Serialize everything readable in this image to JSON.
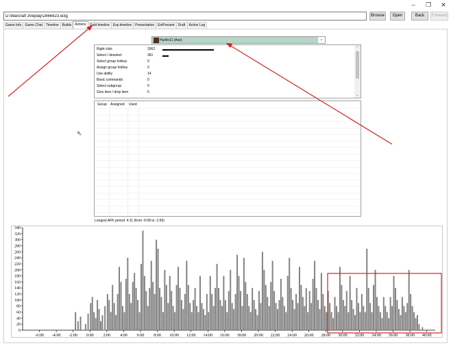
{
  "window": {
    "minimize_glyph": "–",
    "maximize_glyph": "❐",
    "close_glyph": "✕"
  },
  "toolbar": {
    "path_value": "D:\\Warcraft 3\\replay\\2866923.w3g",
    "browse": "Browse",
    "open": "Open",
    "back": "Back",
    "forward": "Forward"
  },
  "tabs": [
    "Game Info",
    "Game Chat",
    "Timeline",
    "Builds",
    "Actions",
    "Gold timeline",
    "Exp timeline",
    "Presentation",
    "ExtPresent",
    "Draft",
    "Action Log"
  ],
  "active_tab": "Actions",
  "player": {
    "name": "Hurillo11 (Axe)",
    "swatch_color": "#5a2b1c",
    "row_color": "#b7d6c7"
  },
  "actions": [
    {
      "label": "Right click",
      "count": "2962",
      "fraction": 1.0
    },
    {
      "label": "Select / deselect",
      "count": "361",
      "fraction": 0.12
    },
    {
      "label": "Select group hotkey",
      "count": "0",
      "fraction": 0
    },
    {
      "label": "Assign group hotkey",
      "count": "0",
      "fraction": 0
    },
    {
      "label": "Use ability",
      "count": "14",
      "fraction": 0
    },
    {
      "label": "Basic commands",
      "count": "0",
      "fraction": 0
    },
    {
      "label": "Select subgroup",
      "count": "0",
      "fraction": 0
    },
    {
      "label": "Give item / drop item",
      "count": "5",
      "fraction": 0
    }
  ],
  "groups": {
    "headers": [
      "Group",
      "Assigned",
      "Used"
    ]
  },
  "afk_text": "Longest AFK period: 4:11 (from -6:08 to -1:56)",
  "chart_data": {
    "type": "bar",
    "title": "",
    "xlabel": "",
    "ylabel": "",
    "ylim": [
      0,
      340
    ],
    "xlim": [
      -8,
      41
    ],
    "y_ticks": [
      0,
      20,
      40,
      60,
      80,
      100,
      120,
      140,
      160,
      180,
      200,
      220,
      240,
      260,
      280,
      300,
      320,
      340
    ],
    "x_tick_labels": [
      "-6:00",
      "-4:00",
      "-2:00",
      "0:00",
      "2:00",
      "4:00",
      "6:00",
      "8:00",
      "10:00",
      "12:00",
      "14:00",
      "16:00",
      "18:00",
      "20:00",
      "22:00",
      "24:00",
      "26:00",
      "28:00",
      "30:00",
      "32:00",
      "34:00",
      "36:00",
      "38:00",
      "40:00"
    ],
    "x_tick_values": [
      -6,
      -4,
      -2,
      0,
      2,
      4,
      6,
      8,
      10,
      12,
      14,
      16,
      18,
      20,
      22,
      24,
      26,
      28,
      30,
      32,
      34,
      36,
      38,
      40
    ],
    "bar_color": "#808080",
    "bars": [
      [
        -1.8,
        60
      ],
      [
        -1.5,
        30
      ],
      [
        -1.2,
        45
      ],
      [
        -0.9,
        0
      ],
      [
        -0.6,
        20
      ],
      [
        -0.3,
        55
      ],
      [
        0.0,
        90
      ],
      [
        0.2,
        110
      ],
      [
        0.4,
        60
      ],
      [
        0.6,
        40
      ],
      [
        0.8,
        100
      ],
      [
        1.0,
        70
      ],
      [
        1.2,
        30
      ],
      [
        1.4,
        50
      ],
      [
        1.7,
        80
      ],
      [
        2.0,
        120
      ],
      [
        2.2,
        100
      ],
      [
        2.4,
        60
      ],
      [
        2.6,
        150
      ],
      [
        2.8,
        90
      ],
      [
        3.0,
        50
      ],
      [
        3.2,
        120
      ],
      [
        3.4,
        210
      ],
      [
        3.6,
        160
      ],
      [
        3.8,
        80
      ],
      [
        4.0,
        60
      ],
      [
        4.2,
        170
      ],
      [
        4.4,
        240
      ],
      [
        4.6,
        120
      ],
      [
        4.8,
        90
      ],
      [
        5.0,
        160
      ],
      [
        5.2,
        190
      ],
      [
        5.4,
        140
      ],
      [
        5.6,
        100
      ],
      [
        5.8,
        60
      ],
      [
        6.0,
        220
      ],
      [
        6.2,
        330
      ],
      [
        6.4,
        180
      ],
      [
        6.6,
        130
      ],
      [
        6.8,
        80
      ],
      [
        7.0,
        140
      ],
      [
        7.2,
        230
      ],
      [
        7.4,
        160
      ],
      [
        7.6,
        120
      ],
      [
        7.8,
        300
      ],
      [
        8.0,
        270
      ],
      [
        8.2,
        140
      ],
      [
        8.4,
        110
      ],
      [
        8.6,
        60
      ],
      [
        8.8,
        200
      ],
      [
        9.0,
        150
      ],
      [
        9.2,
        90
      ],
      [
        9.4,
        180
      ],
      [
        9.6,
        130
      ],
      [
        9.8,
        80
      ],
      [
        10.0,
        60
      ],
      [
        10.2,
        150
      ],
      [
        10.4,
        210
      ],
      [
        10.6,
        140
      ],
      [
        10.8,
        100
      ],
      [
        11.0,
        70
      ],
      [
        11.2,
        120
      ],
      [
        11.4,
        230
      ],
      [
        11.6,
        150
      ],
      [
        11.8,
        90
      ],
      [
        12.0,
        60
      ],
      [
        12.2,
        100
      ],
      [
        12.4,
        140
      ],
      [
        12.6,
        80
      ],
      [
        12.8,
        60
      ],
      [
        13.0,
        180
      ],
      [
        13.2,
        90
      ],
      [
        13.4,
        70
      ],
      [
        13.6,
        50
      ],
      [
        13.8,
        120
      ],
      [
        14.0,
        60
      ],
      [
        14.2,
        180
      ],
      [
        14.4,
        120
      ],
      [
        14.6,
        80
      ],
      [
        14.8,
        140
      ],
      [
        15.0,
        220
      ],
      [
        15.2,
        140
      ],
      [
        15.4,
        100
      ],
      [
        15.6,
        80
      ],
      [
        15.8,
        180
      ],
      [
        16.0,
        100
      ],
      [
        16.2,
        60
      ],
      [
        16.4,
        130
      ],
      [
        16.6,
        200
      ],
      [
        16.8,
        90
      ],
      [
        17.0,
        70
      ],
      [
        17.2,
        120
      ],
      [
        17.4,
        250
      ],
      [
        17.6,
        180
      ],
      [
        17.8,
        130
      ],
      [
        18.0,
        80
      ],
      [
        18.2,
        240
      ],
      [
        18.4,
        160
      ],
      [
        18.6,
        120
      ],
      [
        18.8,
        80
      ],
      [
        19.0,
        60
      ],
      [
        19.2,
        140
      ],
      [
        19.4,
        100
      ],
      [
        19.6,
        70
      ],
      [
        19.8,
        50
      ],
      [
        20.0,
        130
      ],
      [
        20.2,
        90
      ],
      [
        20.4,
        260
      ],
      [
        20.6,
        200
      ],
      [
        20.8,
        150
      ],
      [
        21.0,
        110
      ],
      [
        21.2,
        80
      ],
      [
        21.4,
        160
      ],
      [
        21.6,
        230
      ],
      [
        21.8,
        130
      ],
      [
        22.0,
        90
      ],
      [
        22.2,
        70
      ],
      [
        22.4,
        100
      ],
      [
        22.6,
        170
      ],
      [
        22.8,
        110
      ],
      [
        23.0,
        80
      ],
      [
        23.2,
        60
      ],
      [
        23.4,
        180
      ],
      [
        23.6,
        240
      ],
      [
        23.8,
        140
      ],
      [
        24.0,
        100
      ],
      [
        24.2,
        70
      ],
      [
        24.4,
        120
      ],
      [
        24.6,
        90
      ],
      [
        24.8,
        210
      ],
      [
        25.0,
        150
      ],
      [
        25.2,
        110
      ],
      [
        25.4,
        80
      ],
      [
        25.6,
        140
      ],
      [
        25.8,
        60
      ],
      [
        26.0,
        130
      ],
      [
        26.2,
        90
      ],
      [
        26.4,
        170
      ],
      [
        26.6,
        230
      ],
      [
        26.8,
        140
      ],
      [
        27.0,
        100
      ],
      [
        27.2,
        70
      ],
      [
        27.4,
        190
      ],
      [
        27.6,
        120
      ],
      [
        27.8,
        80
      ],
      [
        28.0,
        60
      ],
      [
        28.2,
        130
      ],
      [
        28.4,
        90
      ],
      [
        28.6,
        60
      ],
      [
        28.8,
        40
      ],
      [
        29.0,
        110
      ],
      [
        29.2,
        80
      ],
      [
        29.4,
        60
      ],
      [
        29.6,
        210
      ],
      [
        29.8,
        150
      ],
      [
        30.0,
        100
      ],
      [
        30.2,
        80
      ],
      [
        30.4,
        130
      ],
      [
        30.6,
        60
      ],
      [
        30.8,
        180
      ],
      [
        31.0,
        100
      ],
      [
        31.2,
        70
      ],
      [
        31.4,
        50
      ],
      [
        31.6,
        140
      ],
      [
        31.8,
        90
      ],
      [
        32.0,
        60
      ],
      [
        32.2,
        120
      ],
      [
        32.4,
        80
      ],
      [
        32.6,
        60
      ],
      [
        32.8,
        270
      ],
      [
        33.0,
        140
      ],
      [
        33.2,
        90
      ],
      [
        33.4,
        60
      ],
      [
        33.6,
        150
      ],
      [
        33.8,
        200
      ],
      [
        34.0,
        110
      ],
      [
        34.2,
        80
      ],
      [
        34.4,
        60
      ],
      [
        34.6,
        40
      ],
      [
        34.8,
        110
      ],
      [
        35.0,
        80
      ],
      [
        35.2,
        60
      ],
      [
        35.4,
        40
      ],
      [
        35.6,
        110
      ],
      [
        35.8,
        80
      ],
      [
        36.0,
        180
      ],
      [
        36.2,
        140
      ],
      [
        36.4,
        100
      ],
      [
        36.6,
        70
      ],
      [
        36.8,
        50
      ],
      [
        37.0,
        110
      ],
      [
        37.2,
        80
      ],
      [
        37.4,
        60
      ],
      [
        37.6,
        90
      ],
      [
        37.8,
        200
      ],
      [
        38.0,
        120
      ],
      [
        38.2,
        80
      ],
      [
        38.4,
        60
      ],
      [
        38.6,
        40
      ],
      [
        38.8,
        50
      ],
      [
        39.0,
        20
      ],
      [
        39.4,
        10
      ]
    ]
  }
}
